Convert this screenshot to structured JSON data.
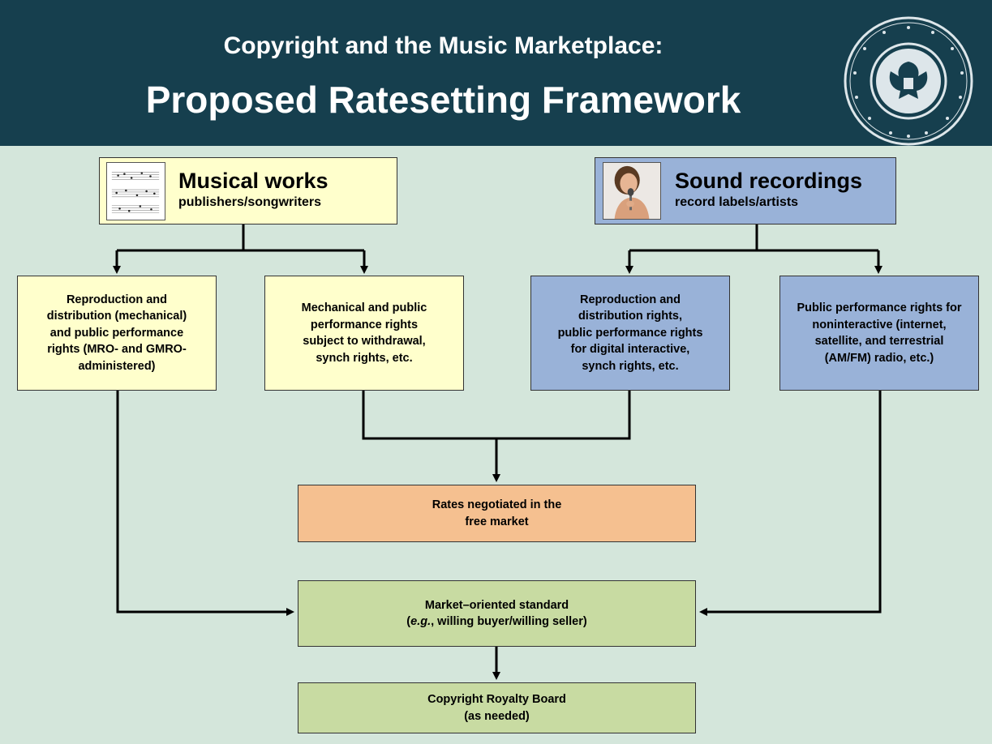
{
  "header": {
    "subtitle": "Copyright and the Music Marketplace:",
    "title": "Proposed Ratesetting Framework"
  },
  "musical_works": {
    "title": "Musical works",
    "subtitle": "publishers/songwriters",
    "icon": "sheet-music-icon"
  },
  "sound_recordings": {
    "title": "Sound recordings",
    "subtitle": "record labels/artists",
    "icon": "singer-photo-icon"
  },
  "rights": [
    {
      "lines": [
        "Reproduction and",
        "distribution (mechanical)",
        "and public performance",
        "rights (MRO- and GMRO-",
        "administered)"
      ]
    },
    {
      "lines": [
        "Mechanical and public",
        "performance rights",
        "subject to withdrawal,",
        "synch rights, etc."
      ]
    },
    {
      "lines": [
        "Reproduction and",
        "distribution rights,",
        "public performance rights",
        "for digital interactive,",
        "synch rights, etc."
      ]
    },
    {
      "lines": [
        "Public performance rights for",
        "noninteractive (internet,",
        "satellite, and terrestrial",
        "(AM/FM) radio, etc.)"
      ]
    }
  ],
  "free_market": {
    "lines": [
      "Rates negotiated in the",
      "free market"
    ]
  },
  "market_standard": {
    "line1": "Market–oriented standard",
    "line2_paren_open": "(",
    "line2_italic": "e.g.",
    "line2_rest": ", willing buyer/willing seller)"
  },
  "crb": {
    "lines": [
      "Copyright Royalty Board",
      "(as needed)"
    ]
  },
  "colors": {
    "header_bg": "#163f4e",
    "page_bg": "#d4e6db",
    "musical_fill": "#ffffcc",
    "sound_fill": "#99b2d8",
    "market_fill": "#f5c090",
    "standard_fill": "#c8dba2"
  }
}
